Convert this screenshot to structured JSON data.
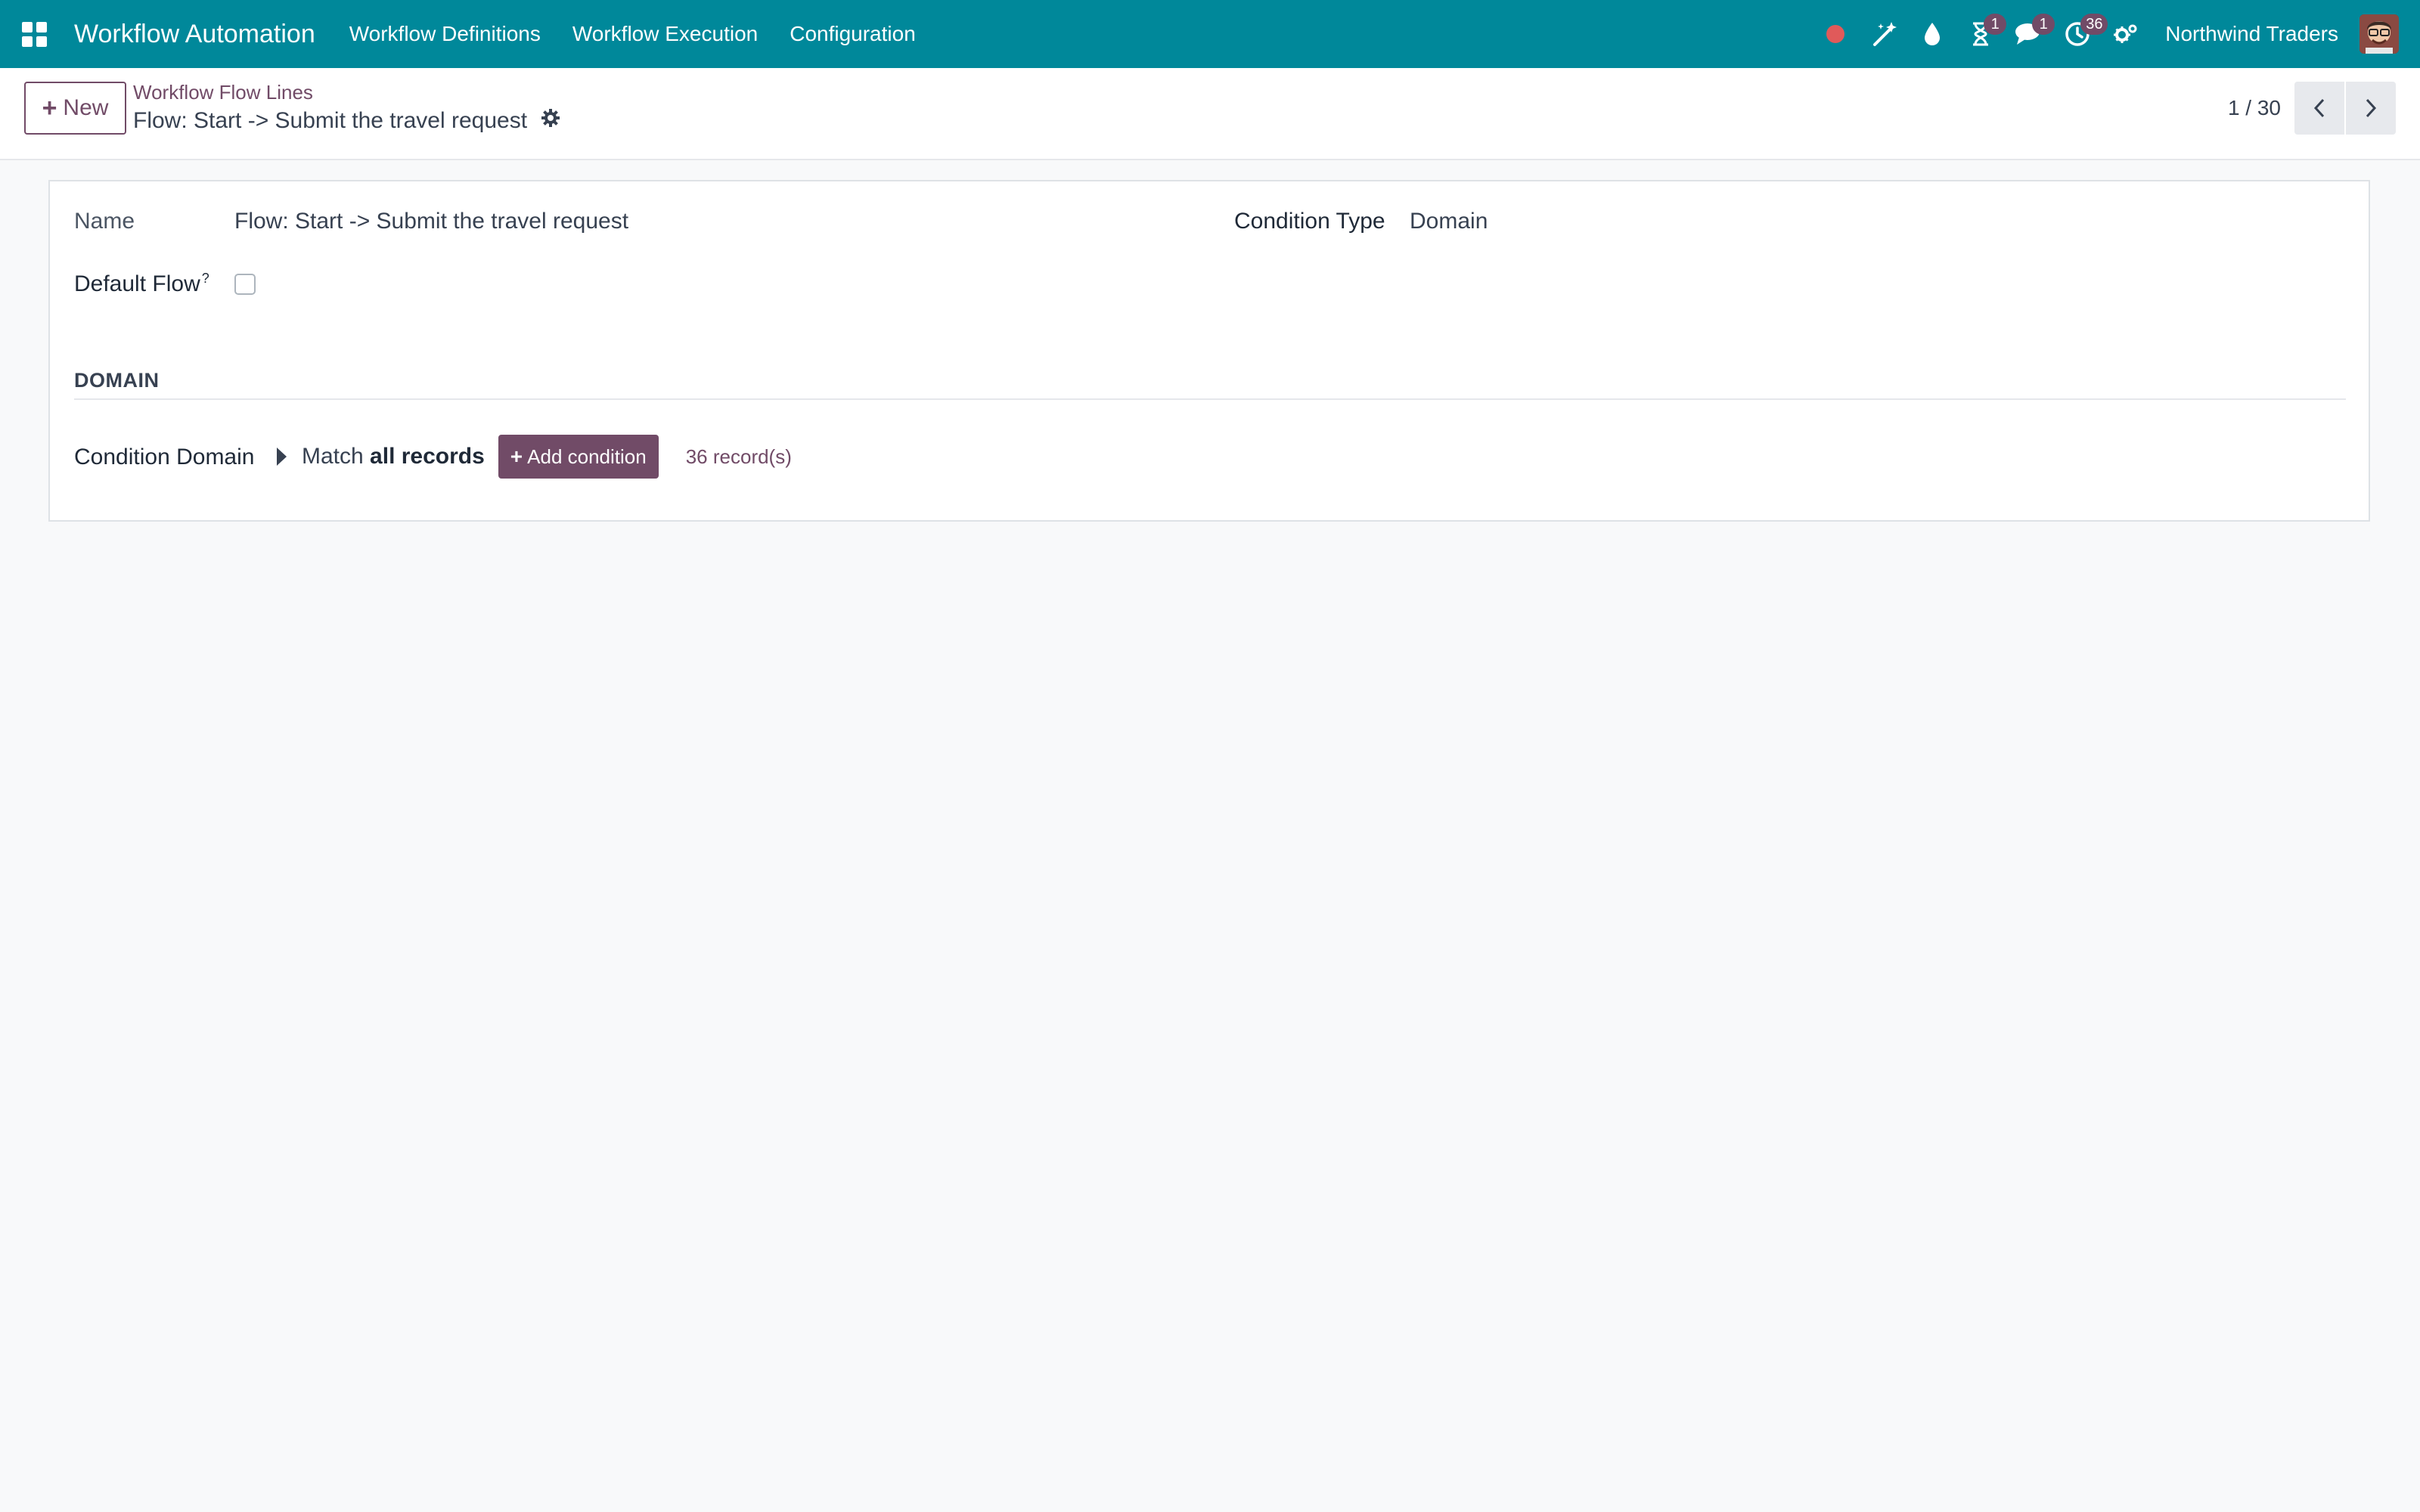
{
  "navbar": {
    "app_title": "Workflow Automation",
    "menu": [
      "Workflow Definitions",
      "Workflow Execution",
      "Configuration"
    ],
    "activity_badge": "1",
    "messages_badge": "1",
    "clock_badge": "36",
    "company": "Northwind Traders",
    "recording_color": "#e05a5a",
    "background_color": "#00889a"
  },
  "control_panel": {
    "new_label": "New",
    "breadcrumb_parent": "Workflow Flow Lines",
    "breadcrumb_current": "Flow: Start -> Submit the travel request",
    "pager_value": "1 / 30"
  },
  "form": {
    "name_label": "Name",
    "name_value": "Flow: Start -> Submit the travel request",
    "condition_type_label": "Condition Type",
    "condition_type_value": "Domain",
    "default_flow_label": "Default Flow",
    "default_flow_help": "?",
    "default_flow_checked": false,
    "section_title": "DOMAIN",
    "condition_domain_label": "Condition Domain",
    "match_prefix": "Match",
    "match_bold": "all records",
    "add_condition_label": "Add condition",
    "records_count": "36 record(s)"
  },
  "icons": [
    "apps-grid-icon",
    "record-dot-icon",
    "magic-wand-icon",
    "droplet-icon",
    "hourglass-icon",
    "chat-icon",
    "clock-icon",
    "settings-icon",
    "gear-icon",
    "chevron-left-icon",
    "chevron-right-icon",
    "caret-right-icon",
    "plus-icon"
  ]
}
